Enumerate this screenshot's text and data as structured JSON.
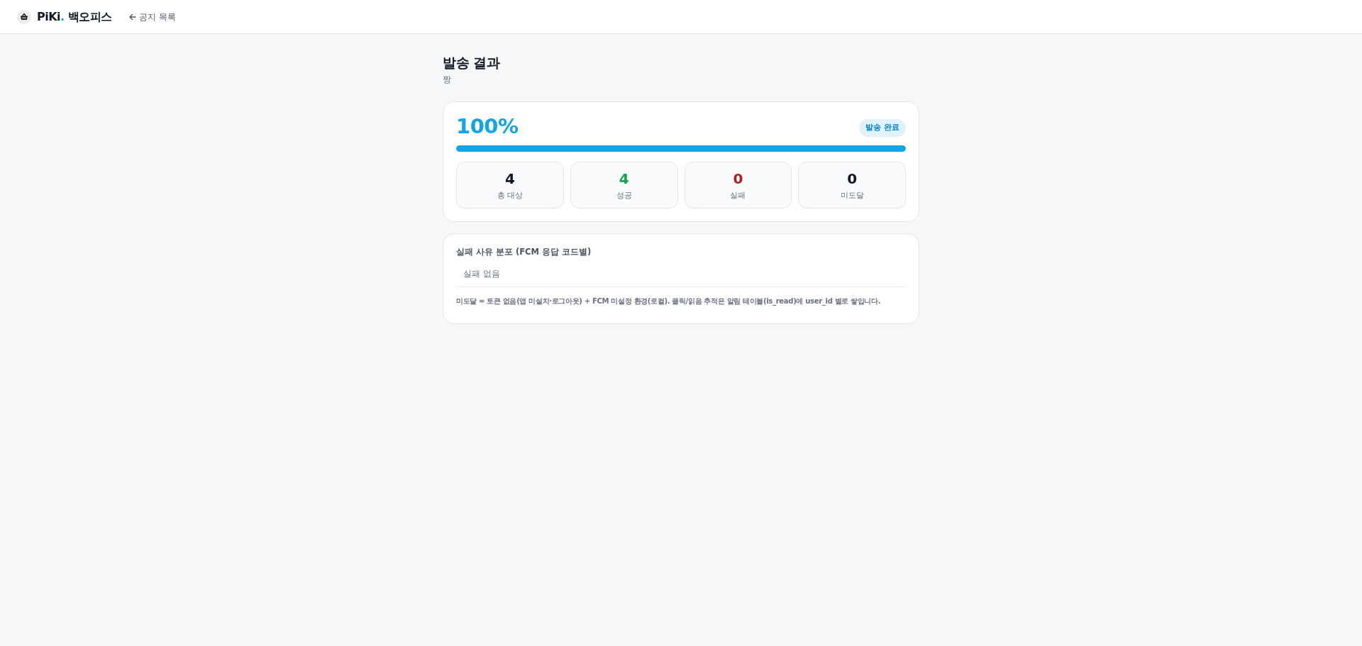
{
  "header": {
    "brand": {
      "name": "PiKi",
      "accent": ".",
      "product": "백오피스"
    },
    "back_link": {
      "label": "공지 목록"
    }
  },
  "page": {
    "title": "발송 결과",
    "subtitle": "짱"
  },
  "progress_card": {
    "percent": "100%",
    "level": 1,
    "status_badge": "발송 완료",
    "stats": [
      {
        "value": "4",
        "label": "총 대상",
        "color": "#111827"
      },
      {
        "value": "4",
        "label": "성공",
        "color": "#16a34a"
      },
      {
        "value": "0",
        "label": "실패",
        "color": "#b91c1c"
      },
      {
        "value": "0",
        "label": "미도달",
        "color": "#111827"
      }
    ]
  },
  "failure_card": {
    "title": "실패 사유 분포 (FCM 응답 코드별)",
    "empty_message": "실패 없음",
    "note": "미도달 = 토큰 없음(앱 미설치·로그아웃) + FCM 미설정 환경(로컬). 클릭/읽음 추적은 알림 테이블(is_read)에 user_id 별로 쌓입니다."
  }
}
